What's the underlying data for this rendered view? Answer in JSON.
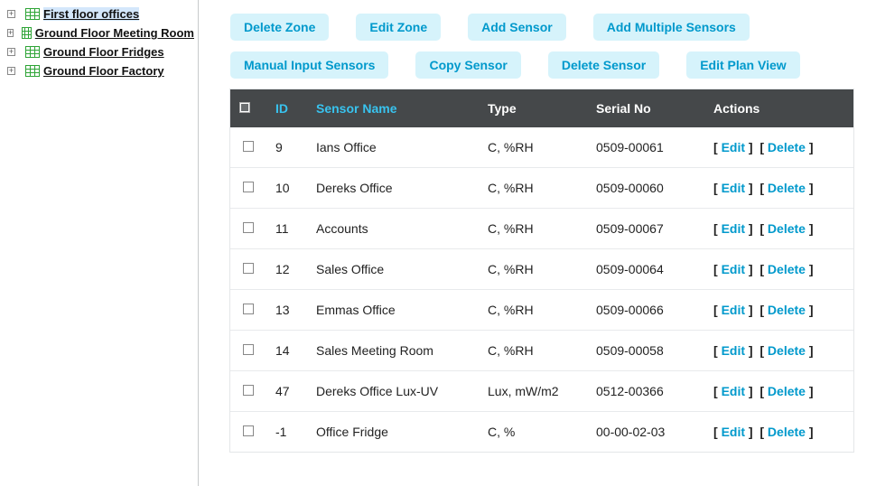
{
  "sidebar": {
    "items": [
      {
        "label": "First floor offices",
        "selected": true
      },
      {
        "label": "Ground Floor Meeting Room",
        "selected": false
      },
      {
        "label": "Ground Floor Fridges",
        "selected": false
      },
      {
        "label": "Ground Floor Factory",
        "selected": false
      }
    ]
  },
  "toolbar": {
    "delete_zone": "Delete Zone",
    "edit_zone": "Edit Zone",
    "add_sensor": "Add Sensor",
    "add_multiple_sensors": "Add Multiple Sensors",
    "manual_input_sensors": "Manual Input Sensors",
    "copy_sensor": "Copy Sensor",
    "delete_sensor": "Delete Sensor",
    "edit_plan_view": "Edit Plan View"
  },
  "table": {
    "headers": {
      "id": "ID",
      "name": "Sensor Name",
      "type": "Type",
      "serial": "Serial No",
      "actions": "Actions"
    },
    "action_labels": {
      "edit": "Edit",
      "delete": "Delete"
    },
    "rows": [
      {
        "id": "9",
        "name": "Ians Office",
        "type": "C, %RH",
        "serial": "0509-00061"
      },
      {
        "id": "10",
        "name": "Dereks Office",
        "type": "C, %RH",
        "serial": "0509-00060"
      },
      {
        "id": "11",
        "name": "Accounts",
        "type": "C, %RH",
        "serial": "0509-00067"
      },
      {
        "id": "12",
        "name": "Sales Office",
        "type": "C, %RH",
        "serial": "0509-00064"
      },
      {
        "id": "13",
        "name": "Emmas Office",
        "type": "C, %RH",
        "serial": "0509-00066"
      },
      {
        "id": "14",
        "name": "Sales Meeting Room",
        "type": "C, %RH",
        "serial": "0509-00058"
      },
      {
        "id": "47",
        "name": "Dereks Office Lux-UV",
        "type": "Lux, mW/m2",
        "serial": "0512-00366"
      },
      {
        "id": "-1",
        "name": "Office Fridge",
        "type": "C, %",
        "serial": "00-00-02-03"
      }
    ]
  }
}
